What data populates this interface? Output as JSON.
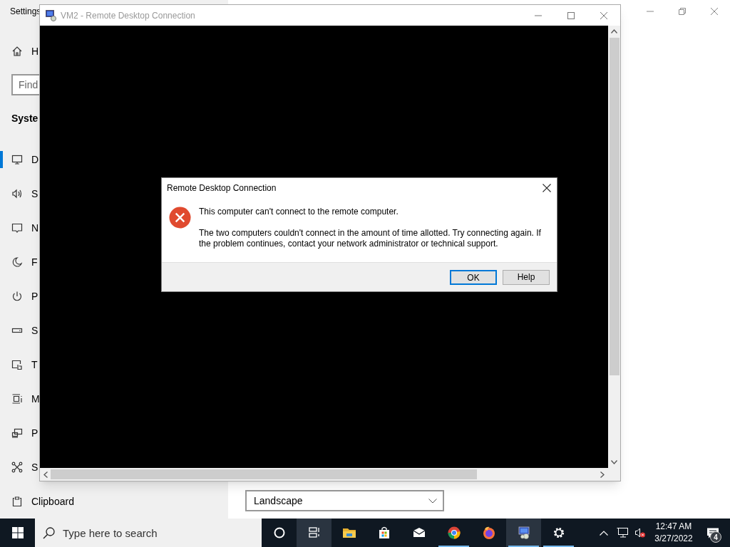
{
  "settings_window": {
    "title": "Settings",
    "home_label": "H",
    "search_placeholder": "Find",
    "section_title": "Syste",
    "items": [
      {
        "kind": "display",
        "label": "D",
        "selected": true
      },
      {
        "kind": "sound",
        "label": "S",
        "selected": false
      },
      {
        "kind": "notifications",
        "label": "N",
        "selected": false
      },
      {
        "kind": "focus",
        "label": "F",
        "selected": false
      },
      {
        "kind": "power",
        "label": "P",
        "selected": false
      },
      {
        "kind": "storage",
        "label": "S",
        "selected": false
      },
      {
        "kind": "tablet",
        "label": "T",
        "selected": false
      },
      {
        "kind": "multitasking",
        "label": "M",
        "selected": false
      },
      {
        "kind": "projecting",
        "label": "P",
        "selected": false
      },
      {
        "kind": "shared",
        "label": "S",
        "selected": false
      },
      {
        "kind": "clipboard",
        "label": "Clipboard",
        "selected": false
      }
    ],
    "orientation_dropdown": {
      "value": "Landscape"
    }
  },
  "rdp_window": {
    "title": "VM2 - Remote Desktop Connection"
  },
  "dialog": {
    "title": "Remote Desktop Connection",
    "heading": "This computer can't connect to the remote computer.",
    "message": "The two computers couldn't connect in the amount of time allotted. Try connecting again. If the problem continues, contact your network administrator or technical support.",
    "buttons": [
      {
        "label": "OK",
        "default": true
      },
      {
        "label": "Help",
        "default": false
      }
    ]
  },
  "taskbar": {
    "search_placeholder": "Type here to search",
    "apps": [
      {
        "kind": "cortana",
        "running": false,
        "highlighted": false
      },
      {
        "kind": "taskview",
        "running": false,
        "highlighted": true
      },
      {
        "kind": "explorer",
        "running": false,
        "highlighted": false
      },
      {
        "kind": "store",
        "running": false,
        "highlighted": false
      },
      {
        "kind": "mail",
        "running": false,
        "highlighted": false
      },
      {
        "kind": "chrome",
        "running": true,
        "highlighted": false
      },
      {
        "kind": "firefox",
        "running": false,
        "highlighted": false
      },
      {
        "kind": "rdp",
        "running": true,
        "highlighted": true
      },
      {
        "kind": "settings",
        "running": true,
        "highlighted": false
      }
    ],
    "time": "12:47 AM",
    "date": "3/27/2022",
    "notification_count": "4"
  }
}
